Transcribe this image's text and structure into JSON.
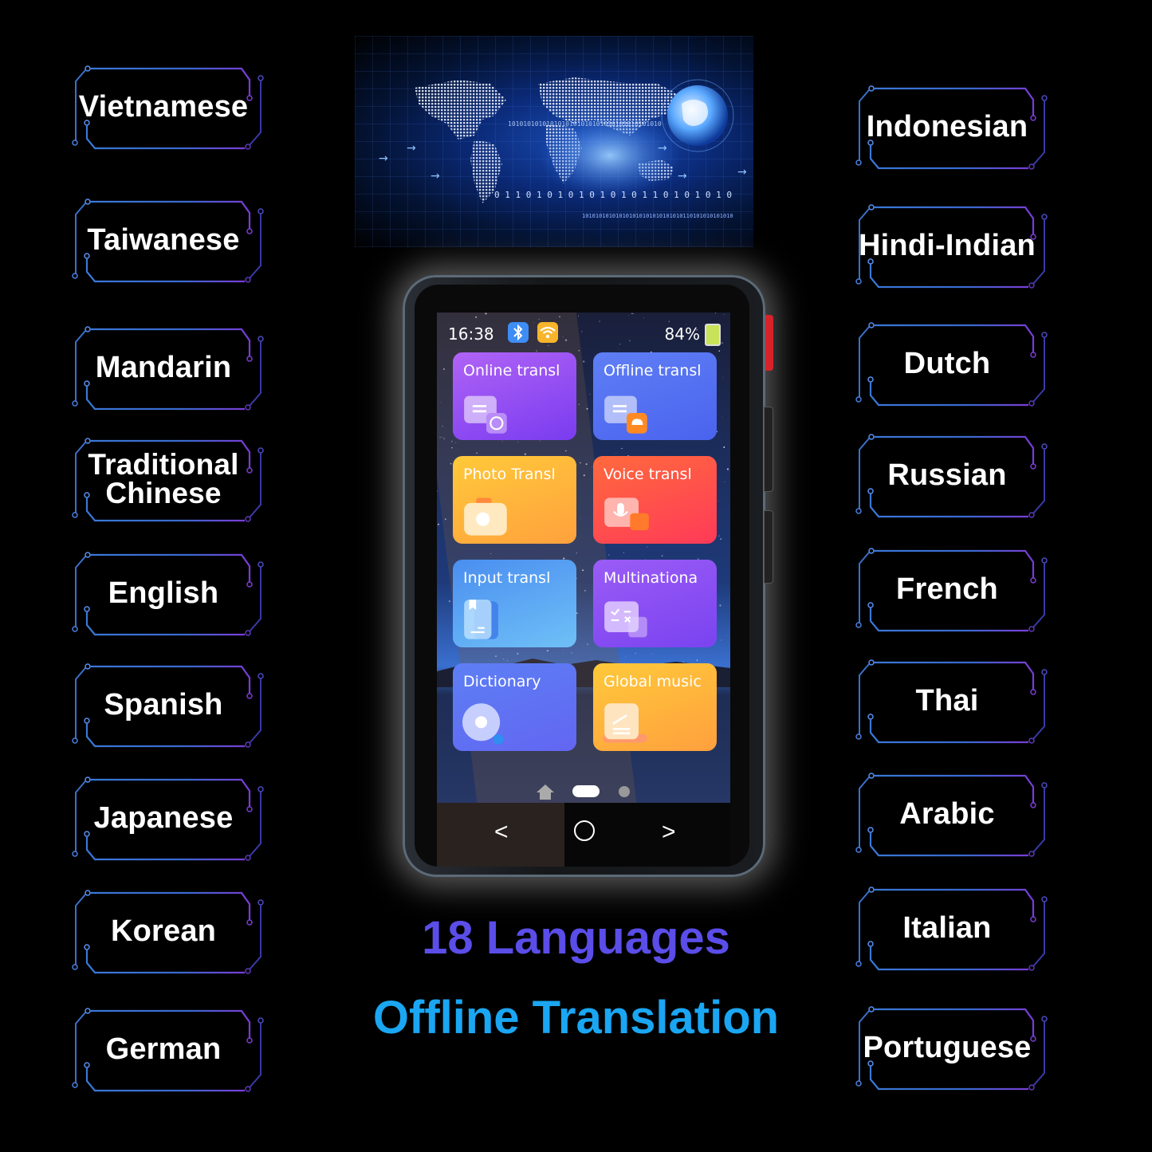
{
  "left_languages": [
    "Vietnamese",
    "Taiwanese",
    "Mandarin",
    "Traditional Chinese",
    "English",
    "Spanish",
    "Japanese",
    "Korean",
    "German"
  ],
  "right_languages": [
    "Indonesian",
    "Hindi-Indian",
    "Dutch",
    "Russian",
    "French",
    "Thai",
    "Arabic",
    "Italian",
    "Portuguese"
  ],
  "banner": {
    "binary_line_1": "1010101010101010101010101010101010101010",
    "binary_line_2": "0 1 1 0 1 0 1 0 1 0 1 0 1 0 1 1 0 1 0 1 0 1 0",
    "binary_line_3": "101010101010101010101010101010110101010101010"
  },
  "device": {
    "status_bar": {
      "time": "16:38",
      "battery_percent": "84%",
      "bluetooth_icon": "bluetooth-icon",
      "wifi_icon": "wifi-icon"
    },
    "apps": [
      {
        "label": "Online transl",
        "icon": "online-translate-icon",
        "color_top": "#b063f5",
        "color_bottom": "#7a3cf0"
      },
      {
        "label": "Offline transl",
        "icon": "offline-translate-icon",
        "color_top": "#5f7ff5",
        "color_bottom": "#4a63ee"
      },
      {
        "label": "Photo Transl",
        "icon": "camera-icon",
        "color_top": "#ffc93a",
        "color_bottom": "#ffa13d"
      },
      {
        "label": "Voice transl",
        "icon": "microphone-icon",
        "color_top": "#ff6a3d",
        "color_bottom": "#ff3a58"
      },
      {
        "label": "Input transl",
        "icon": "book-icon",
        "color_top": "#4a8ef0",
        "color_bottom": "#6fc0f7"
      },
      {
        "label": "Multinationa",
        "icon": "multinational-chat-icon",
        "color_top": "#9b5cf6",
        "color_bottom": "#7a43f0"
      },
      {
        "label": "Dictionary",
        "icon": "dictionary-search-icon",
        "color_top": "#5d7ff4",
        "color_bottom": "#6266f2"
      },
      {
        "label": "Global music",
        "icon": "music-note-icon",
        "color_top": "#ffc93a",
        "color_bottom": "#ffa03e"
      }
    ],
    "pager": {
      "pages": 2,
      "current_page": 1
    },
    "nav": {
      "back": "<",
      "home": "○",
      "forward": ">"
    }
  },
  "headline": {
    "count_text": "18 Languages",
    "subtitle_text": "Offline Translation",
    "count_color": "#5a4de8",
    "subtitle_color": "#1aa6f2"
  }
}
